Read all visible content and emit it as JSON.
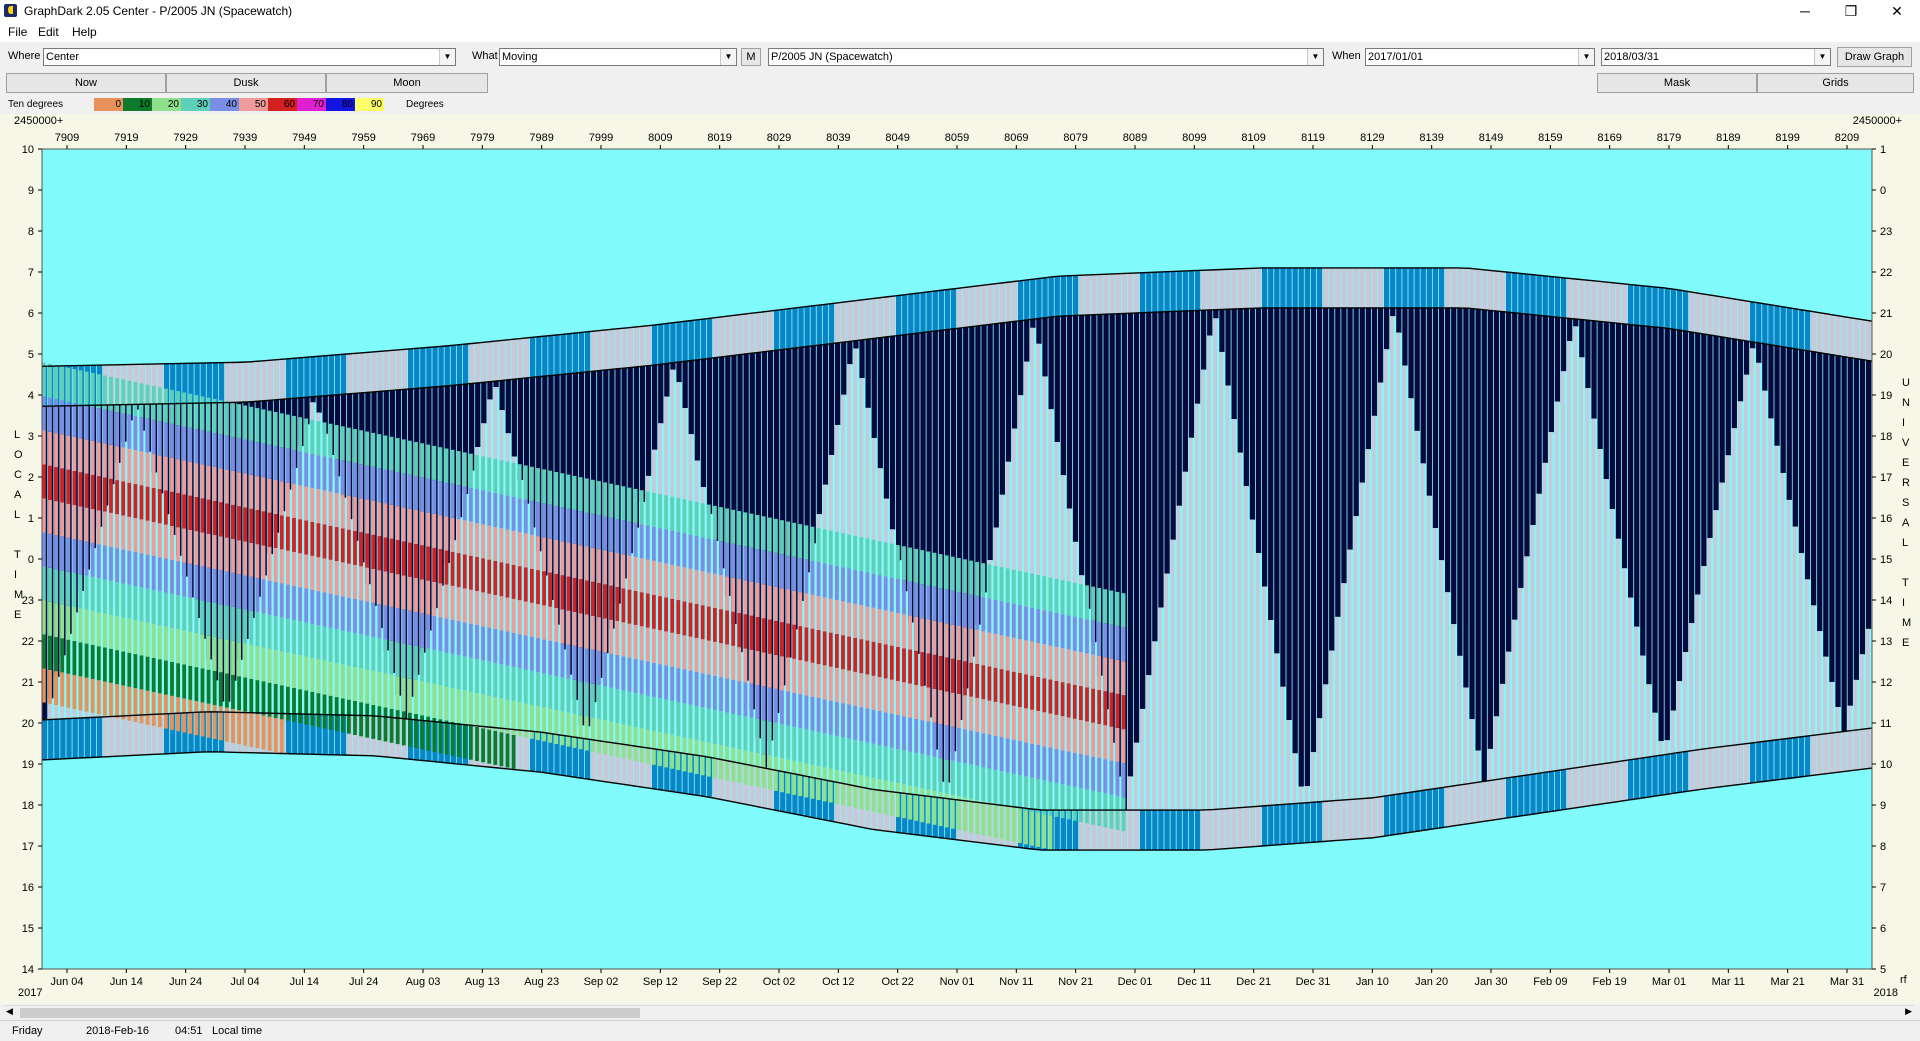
{
  "window": {
    "title": "GraphDark 2.05  Center  -  P/2005 JN (Spacewatch)",
    "minimize_glyph": "─",
    "maximize_glyph": "❐",
    "close_glyph": "✕"
  },
  "menu": [
    "File",
    "Edit",
    "Help"
  ],
  "toolbar": {
    "where_label": "Where",
    "where_value": "Center",
    "what_label": "What",
    "what_value": "Moving",
    "m_button": "M",
    "object_value": "P/2005 JN (Spacewatch)",
    "when_label": "When",
    "start_date": "2017/01/01",
    "end_date": "2018/03/31",
    "draw_button": "Draw Graph"
  },
  "buttons": {
    "now": "Now",
    "dusk": "Dusk",
    "moon": "Moon",
    "mask": "Mask",
    "grids": "Grids"
  },
  "legend": {
    "label": "Ten degrees",
    "units": "Degrees",
    "values": [
      "0",
      "10",
      "20",
      "30",
      "40",
      "50",
      "60",
      "70",
      "80",
      "90"
    ],
    "colors": [
      "#e8915a",
      "#0e7a2e",
      "#8fe08a",
      "#5fd0b8",
      "#7b8ee6",
      "#f09a9a",
      "#d42020",
      "#e020d0",
      "#1414e0",
      "#ffff6a"
    ]
  },
  "chart_data": {
    "type": "heatmap",
    "description_words": "Altitude bands of object by local time across dates",
    "jd_prefix_left": "2450000+",
    "jd_prefix_right": "2450000+",
    "jd_ticks": [
      "7909",
      "7919",
      "7929",
      "7939",
      "7949",
      "7959",
      "7969",
      "7979",
      "7989",
      "7999",
      "8009",
      "8019",
      "8029",
      "8039",
      "8049",
      "8059",
      "8069",
      "8079",
      "8089",
      "8099",
      "8109",
      "8119",
      "8129",
      "8139",
      "8149",
      "8159",
      "8169",
      "8179",
      "8189",
      "8199",
      "8209"
    ],
    "date_ticks": [
      "Jun 04",
      "Jun 14",
      "Jun 24",
      "Jul 04",
      "Jul 14",
      "Jul 24",
      "Aug 03",
      "Aug 13",
      "Aug 23",
      "Sep 02",
      "Sep 12",
      "Sep 22",
      "Oct 02",
      "Oct 12",
      "Oct 22",
      "Nov 01",
      "Nov 11",
      "Nov 21",
      "Dec 01",
      "Dec 11",
      "Dec 21",
      "Dec 31",
      "Jan 10",
      "Jan 20",
      "Jan 30",
      "Feb 09",
      "Feb 19",
      "Mar 01",
      "Mar 11",
      "Mar 21",
      "Mar 31"
    ],
    "year_left": "2017",
    "year_right": "2018",
    "corner_right_bottom": "rf",
    "left_axis_ticks": [
      "10",
      "9",
      "8",
      "7",
      "6",
      "5",
      "4",
      "3",
      "2",
      "1",
      "0",
      "23",
      "22",
      "21",
      "20",
      "19",
      "18",
      "17",
      "16",
      "15",
      "14"
    ],
    "right_axis_ticks": [
      "1",
      "0",
      "23",
      "22",
      "21",
      "20",
      "19",
      "18",
      "17",
      "16",
      "15",
      "14",
      "13",
      "12",
      "11",
      "10",
      "9",
      "8",
      "7",
      "6",
      "5"
    ],
    "left_axis_label": [
      "L",
      "O",
      "C",
      "A",
      "L",
      "",
      "T",
      "I",
      "M",
      "E"
    ],
    "right_axis_label": [
      "U",
      "N",
      "I",
      "V",
      "E",
      "R",
      "S",
      "A",
      "L",
      "",
      "T",
      "I",
      "M",
      "E"
    ],
    "colors": {
      "day": "#80fafa",
      "twilight": "#0a86c6",
      "night": "#07083e",
      "moonlight": "#c8c8d8"
    },
    "dusk_time_hours": [
      19.1,
      19.3,
      19.2,
      18.8,
      18.2,
      17.4,
      16.9,
      16.9,
      17.2,
      17.8,
      18.4,
      18.9
    ],
    "dawn_time_hours": [
      4.7,
      4.8,
      5.2,
      5.7,
      6.3,
      6.9,
      7.1,
      7.1,
      6.6,
      5.8
    ],
    "lunar_phase_period_days": 29.5
  },
  "status": {
    "day": "Friday",
    "date": "2018-Feb-16",
    "time": "04:51",
    "mode": "Local time"
  }
}
